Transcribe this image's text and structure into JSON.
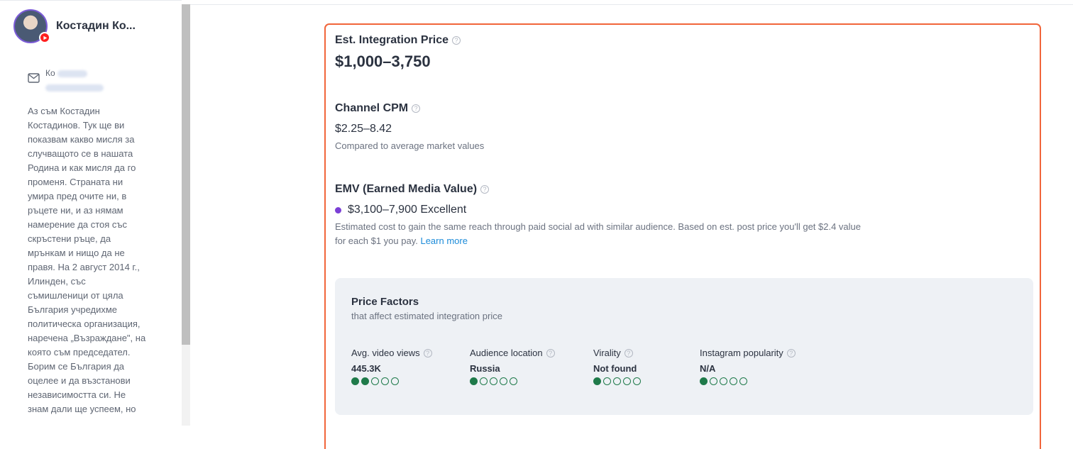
{
  "sidebar": {
    "profile_name": "Костадин Ко...",
    "contact_prefix": "Ко",
    "bio": "Аз съм Костадин Костадинов. Тук ще ви показвам какво мисля за случващото се в нашата Родина и как мисля да го променя. Страната ни умира пред очите ни, в ръцете ни, и аз нямам намерение да стоя със скръстени ръце, да мрънкам и нищо да не правя. На 2 август 2014 г., Илинден, със съмишленици от цяла България учредихме политическа организация, наречена „Възраждане\", на която съм председател. Борим се България да оцелее и да възстанови независимостта си. Не знам дали ще успеем, но"
  },
  "pricing": {
    "integration_title": "Est. Integration Price",
    "integration_price": "$1,000–3,750",
    "cpm_title": "Channel CPM",
    "cpm_value": "$2.25–8.42",
    "cpm_note": "Compared to average market values",
    "emv_title": "EMV (Earned Media Value)",
    "emv_value": "$3,100–7,900 Excellent",
    "emv_note_1": "Estimated cost to gain the same reach through paid social ad with similar audience. Based on est. post price you'll get $2.4 value",
    "emv_note_2": "for each $1 you pay.",
    "learn_more": "Learn more",
    "help_glyph": "?"
  },
  "factors": {
    "title": "Price Factors",
    "subtitle": "that affect estimated integration price",
    "items": [
      {
        "label": "Avg. video views",
        "value": "445.3K",
        "level": 2
      },
      {
        "label": "Audience location",
        "value": "Russia",
        "level": 1
      },
      {
        "label": "Virality",
        "value": "Not found",
        "level": 1
      },
      {
        "label": "Instagram popularity",
        "value": "N/A",
        "level": 1
      }
    ],
    "max_level": 5
  },
  "colors": {
    "accent_border": "#f1653a",
    "dot_green": "#1f7a4a",
    "emv_purple": "#7b3fd6",
    "link": "#1b8bd9"
  }
}
